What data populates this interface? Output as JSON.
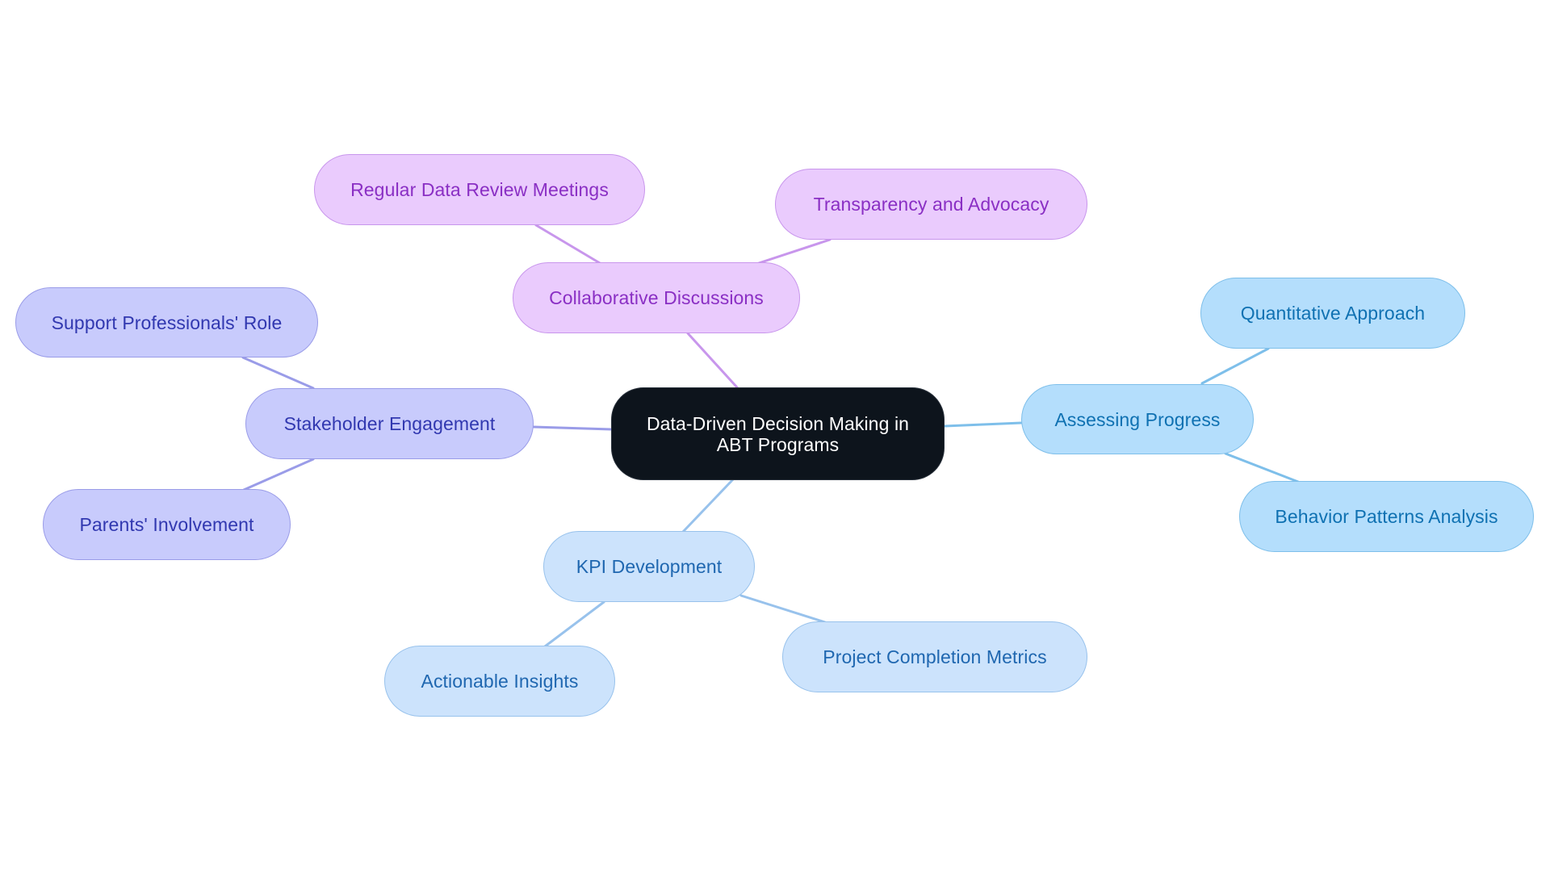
{
  "diagram": {
    "type": "mind-map",
    "root": {
      "id": "n-root",
      "label": "Data-Driven Decision Making in ABT Programs",
      "fill": "#0d141c",
      "stroke": "#2a323c",
      "text_color": "#ffffff"
    },
    "branches": [
      {
        "id": "n-collab",
        "label": "Collaborative Discussions",
        "fill": "#eacbfd",
        "stroke": "#c896ec",
        "text_color": "#8a2fc4",
        "edge_color": "#c896ec",
        "children": [
          {
            "id": "n-regular",
            "label": "Regular Data Review Meetings"
          },
          {
            "id": "n-transp",
            "label": "Transparency and Advocacy"
          }
        ]
      },
      {
        "id": "n-stake",
        "label": "Stakeholder Engagement",
        "fill": "#c8cbfc",
        "stroke": "#9a9ce8",
        "text_color": "#3138b0",
        "edge_color": "#9a9ce8",
        "children": [
          {
            "id": "n-support",
            "label": "Support Professionals' Role"
          },
          {
            "id": "n-parents",
            "label": "Parents' Involvement"
          }
        ]
      },
      {
        "id": "n-kpi",
        "label": "KPI Development",
        "fill": "#cce3fc",
        "stroke": "#98c2ec",
        "text_color": "#1f67b0",
        "edge_color": "#98c2ec",
        "children": [
          {
            "id": "n-action",
            "label": "Actionable Insights"
          },
          {
            "id": "n-project",
            "label": "Project Completion Metrics"
          }
        ]
      },
      {
        "id": "n-assess",
        "label": "Assessing Progress",
        "fill": "#b4defc",
        "stroke": "#7ebfea",
        "text_color": "#0f71b2",
        "edge_color": "#7ebfea",
        "children": [
          {
            "id": "n-quant",
            "label": "Quantitative Approach"
          },
          {
            "id": "n-behav",
            "label": "Behavior Patterns Analysis"
          }
        ]
      }
    ]
  }
}
